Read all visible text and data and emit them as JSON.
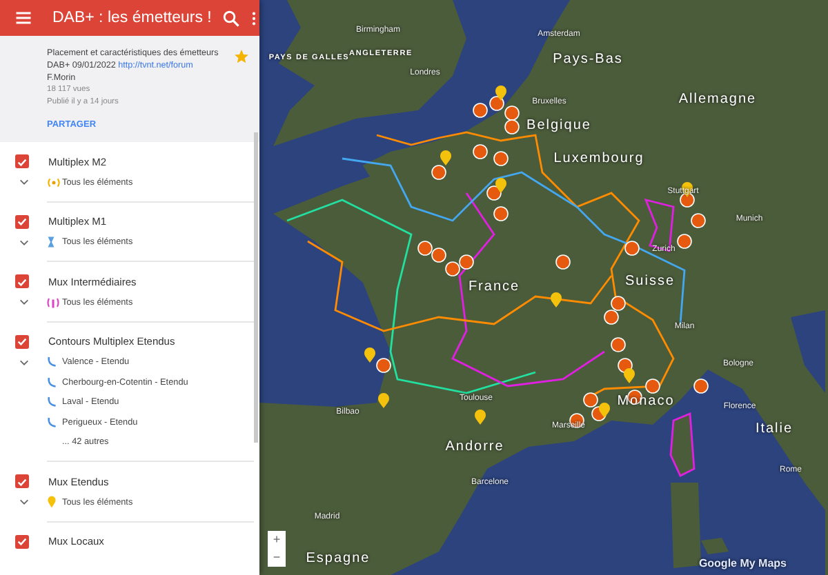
{
  "header": {
    "title": "DAB+ : les émetteurs !"
  },
  "info": {
    "description_lines": [
      "Placement et caractéristiques des émetteurs",
      "DAB+ 09/01/2022 "
    ],
    "link": "http://tvnt.net/forum",
    "author": "F.Morin",
    "views": "18 117 vues",
    "published": "Publié il y a 14 jours",
    "share": "PARTAGER",
    "starred": true
  },
  "layers": [
    {
      "name": "Multiplex M2",
      "checked": true,
      "items": [
        {
          "kind": "waves",
          "label": "Tous les éléments"
        }
      ]
    },
    {
      "name": "Multiplex M1",
      "checked": true,
      "items": [
        {
          "kind": "mast",
          "label": "Tous les éléments"
        }
      ]
    },
    {
      "name": "Mux Intermédiaires",
      "checked": true,
      "items": [
        {
          "kind": "antenna",
          "label": "Tous les éléments"
        }
      ]
    },
    {
      "name": "Contours Multiplex Etendus",
      "checked": true,
      "items": [
        {
          "kind": "contour",
          "label": "Valence - Etendu"
        },
        {
          "kind": "contour",
          "label": "Cherbourg-en-Cotentin - Etendu"
        },
        {
          "kind": "contour",
          "label": "Laval - Etendu"
        },
        {
          "kind": "contour",
          "label": "Perigueux - Etendu"
        },
        {
          "kind": "more",
          "label": "... 42 autres"
        }
      ]
    },
    {
      "name": "Mux Etendus",
      "checked": true,
      "items": [
        {
          "kind": "pin",
          "label": "Tous les éléments"
        }
      ]
    },
    {
      "name": "Mux Locaux",
      "checked": true
    }
  ],
  "map": {
    "labels": [
      {
        "kind": "country",
        "text": "PAYS DE GALLES"
      },
      {
        "kind": "country",
        "text": "ANGLETERRE"
      },
      {
        "kind": "city",
        "text": "Birmingham"
      },
      {
        "kind": "city",
        "text": "Londres"
      },
      {
        "kind": "city",
        "text": "Amsterdam"
      },
      {
        "kind": "major",
        "text": "Pays-Bas"
      },
      {
        "kind": "city",
        "text": "Bruxelles"
      },
      {
        "kind": "major",
        "text": "Belgique"
      },
      {
        "kind": "major",
        "text": "Allemagne"
      },
      {
        "kind": "major",
        "text": "Luxembourg"
      },
      {
        "kind": "city",
        "text": "Stuttgart"
      },
      {
        "kind": "city",
        "text": "Munich"
      },
      {
        "kind": "city",
        "text": "Zurich"
      },
      {
        "kind": "major",
        "text": "Suisse"
      },
      {
        "kind": "major",
        "text": "France"
      },
      {
        "kind": "city",
        "text": "Milan"
      },
      {
        "kind": "city",
        "text": "Bologne"
      },
      {
        "kind": "city",
        "text": "Toulouse"
      },
      {
        "kind": "major",
        "text": "Monaco"
      },
      {
        "kind": "city",
        "text": "Florence"
      },
      {
        "kind": "city",
        "text": "Bilbao"
      },
      {
        "kind": "city",
        "text": "Marseille"
      },
      {
        "kind": "major",
        "text": "Italie"
      },
      {
        "kind": "major",
        "text": "Andorre"
      },
      {
        "kind": "city",
        "text": "Rome"
      },
      {
        "kind": "city",
        "text": "Barcelone"
      },
      {
        "kind": "city",
        "text": "Madrid"
      },
      {
        "kind": "major",
        "text": "Espagne"
      }
    ],
    "zoom_in": "+",
    "zoom_out": "−",
    "attribution": "Google My Maps"
  }
}
